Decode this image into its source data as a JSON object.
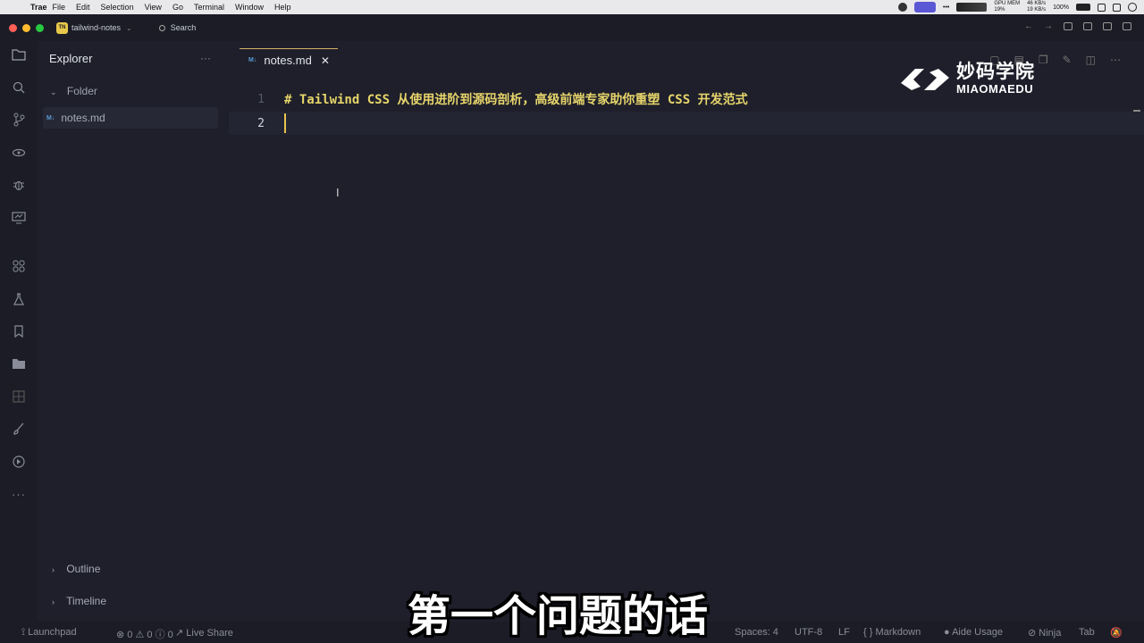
{
  "menubar": {
    "app": "Trae",
    "items": [
      "File",
      "Edit",
      "Selection",
      "View",
      "Go",
      "Terminal",
      "Window",
      "Help"
    ],
    "gpu_label": "GPU",
    "mem_label": "MEM",
    "mem_value": "19%",
    "net_up": "46 KB/s",
    "net_down": "19 KB/s",
    "battery": "100%"
  },
  "titlebar": {
    "project_badge": "TN",
    "project_name": "tailwind-notes",
    "search_label": "Search"
  },
  "sidebar": {
    "title": "Explorer",
    "more": "···",
    "folder": "Folder",
    "file": "notes.md",
    "file_badge": "M↓",
    "outline": "Outline",
    "timeline": "Timeline"
  },
  "editor": {
    "tab_label": "notes.md",
    "tab_badge": "M↓",
    "lines": [
      {
        "num": "1",
        "text": "# Tailwind CSS 从使用进阶到源码剖析，高级前端专家助你重塑 CSS 开发范式"
      },
      {
        "num": "2",
        "text": ""
      }
    ]
  },
  "watermark": {
    "cn": "妙码学院",
    "en": "MIAOMAEDU"
  },
  "statusbar": {
    "launchpad": "Launchpad",
    "errors": "0",
    "warnings": "0",
    "info": "0",
    "live_share": "Live Share",
    "spaces": "Spaces: 4",
    "encoding": "UTF-8",
    "eol": "LF",
    "language": "Markdown",
    "aide": "Aide Usage",
    "ninja": "Ninja",
    "tab": "Tab"
  },
  "subtitle": "第一个问题的话"
}
